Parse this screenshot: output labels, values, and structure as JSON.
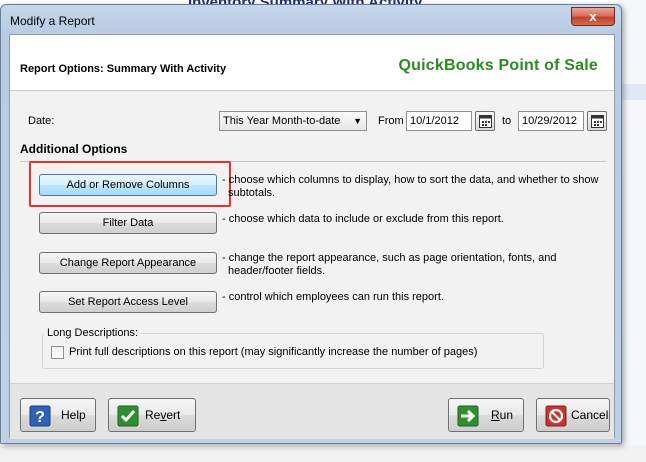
{
  "background": {
    "title": "Inventory Summary With Activity"
  },
  "window": {
    "title": "Modify a Report",
    "close_glyph": "x"
  },
  "header": {
    "report_title": "Report Options: Summary With Activity",
    "brand": "QuickBooks Point of Sale",
    "brand_color": "#2e8b22"
  },
  "date": {
    "label": "Date:",
    "range_selected": "This Year Month-to-date",
    "from_label": "From",
    "from_value": "10/1/2012",
    "to_label": "to",
    "to_value": "10/29/2012"
  },
  "additional": {
    "title": "Additional Options",
    "options": [
      {
        "button": "Add or Remove Columns",
        "desc_line1": "- choose which columns to display, how to sort the data, and whether to show",
        "desc_line2": "subtotals."
      },
      {
        "button": "Filter Data",
        "desc_line1": "- choose which data to include or exclude from this report.",
        "desc_line2": ""
      },
      {
        "button": "Change Report Appearance",
        "desc_line1": "- change the report appearance, such as page orientation, fonts, and",
        "desc_line2": "header/footer fields."
      },
      {
        "button": "Set Report Access Level",
        "desc_line1": "- control which employees can run this report.",
        "desc_line2": ""
      }
    ],
    "highlight_color": "#e8312c"
  },
  "long_descriptions": {
    "group_label": "Long Descriptions:",
    "checkbox_label": "Print full descriptions on this report (may significantly increase the number of pages)",
    "checked": false
  },
  "footer": {
    "help_pre": "",
    "help_ul": "",
    "help_post": "Help",
    "revert_pre": "Re",
    "revert_ul": "v",
    "revert_post": "ert",
    "run_pre": "",
    "run_ul": "R",
    "run_post": "un",
    "cancel_label": "Cancel"
  }
}
